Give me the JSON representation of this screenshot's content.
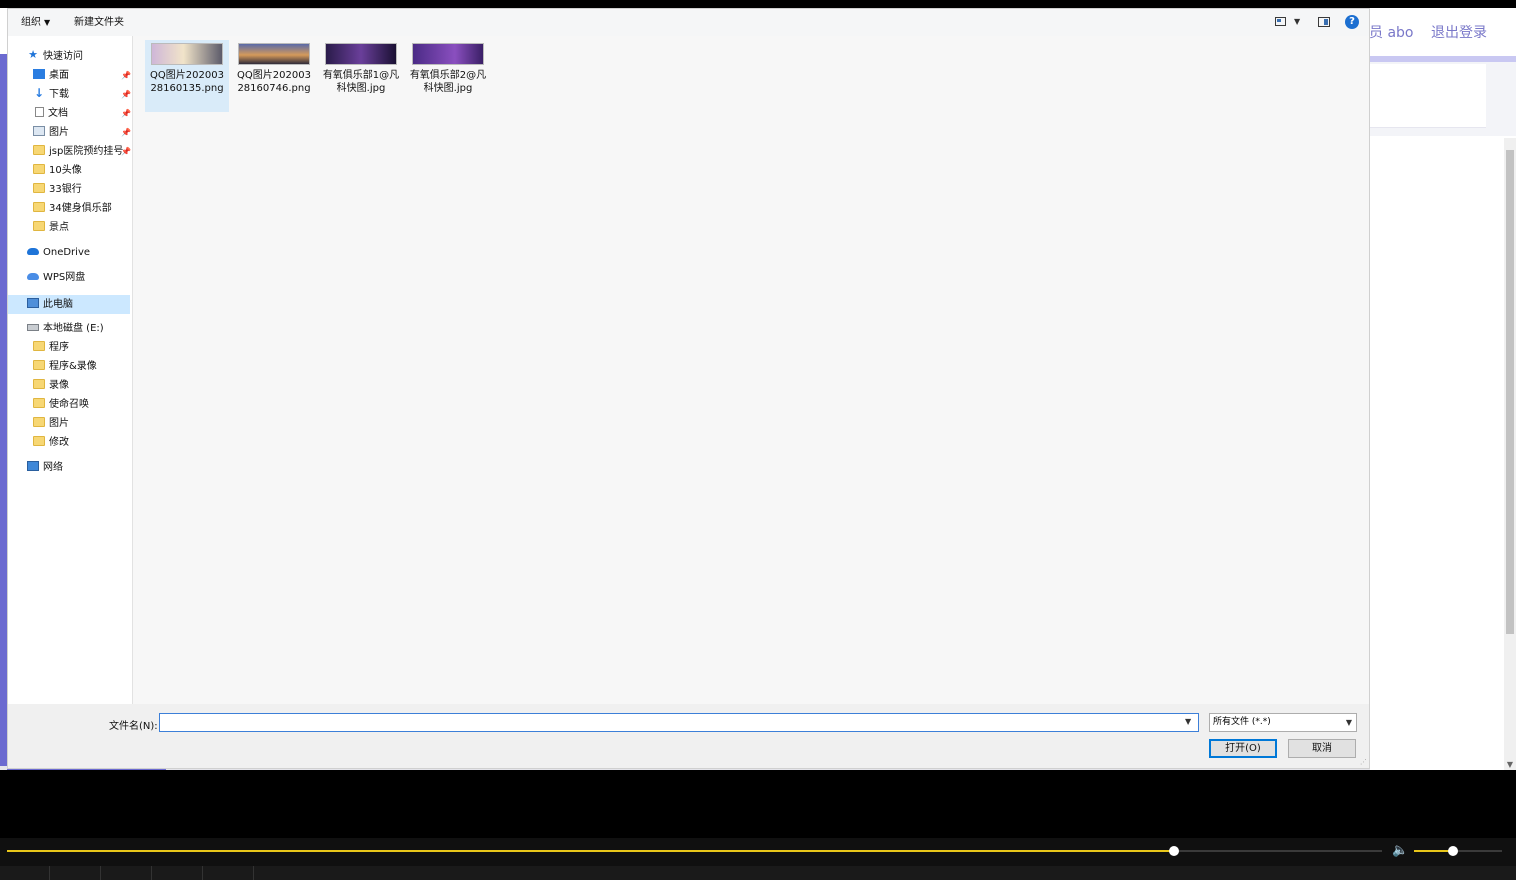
{
  "background_page": {
    "user_label": "员 abo",
    "logout_label": "退出登录"
  },
  "toolbar": {
    "organize_label": "组织",
    "new_folder_label": "新建文件夹"
  },
  "nav": {
    "quick_access": "快速访问",
    "items": [
      {
        "label": "桌面",
        "icon": "desktop-icon",
        "pinned": true
      },
      {
        "label": "下载",
        "icon": "download-icon",
        "pinned": true
      },
      {
        "label": "文档",
        "icon": "document-icon",
        "pinned": true
      },
      {
        "label": "图片",
        "icon": "pictures-icon",
        "pinned": true
      },
      {
        "label": "jsp医院预约挂号",
        "icon": "folder-icon",
        "pinned": true
      },
      {
        "label": "10头像",
        "icon": "folder-icon",
        "pinned": false
      },
      {
        "label": "33银行",
        "icon": "folder-icon",
        "pinned": false
      },
      {
        "label": "34健身俱乐部",
        "icon": "folder-icon",
        "pinned": false
      },
      {
        "label": "景点",
        "icon": "folder-icon",
        "pinned": false
      }
    ],
    "onedrive": "OneDrive",
    "wps": "WPS网盘",
    "this_pc": "此电脑",
    "drive": "本地磁盘 (E:)",
    "drive_items": [
      {
        "label": "程序"
      },
      {
        "label": "程序&录像"
      },
      {
        "label": "录像"
      },
      {
        "label": "使命召唤"
      },
      {
        "label": "图片"
      },
      {
        "label": "修改"
      }
    ],
    "network": "网络"
  },
  "files": [
    {
      "name": "QQ图片20200328160135.png",
      "selected": true
    },
    {
      "name": "QQ图片20200328160746.png",
      "selected": false
    },
    {
      "name": "有氧俱乐部1@凡科快图.jpg",
      "selected": false
    },
    {
      "name": "有氧俱乐部2@凡科快图.jpg",
      "selected": false
    }
  ],
  "bottom": {
    "filename_label": "文件名(N):",
    "filename_value": "",
    "filetype_selected": "所有文件 (*.*)",
    "open_label": "打开(O)",
    "cancel_label": "取消"
  },
  "player": {
    "progress": 0.849,
    "volume": 0.44
  },
  "colors": {
    "accent": "#6b6ad0",
    "player_fill": "#e8c61a",
    "selection": "#cce8ff"
  }
}
